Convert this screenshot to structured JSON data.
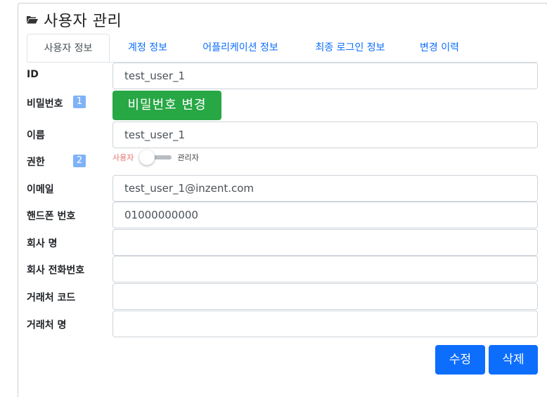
{
  "page": {
    "title": "사용자 관리",
    "title_icon": "folder-open-icon"
  },
  "tabs": [
    {
      "label": "사용자 정보",
      "active": true
    },
    {
      "label": "계정 정보"
    },
    {
      "label": "어플리케이션 정보"
    },
    {
      "label": "최종 로그인 정보"
    },
    {
      "label": "변경 이력"
    }
  ],
  "form": {
    "id": {
      "label": "ID",
      "value": "test_user_1"
    },
    "password": {
      "label": "비밀번호",
      "badge": "1",
      "button_label": "비밀번호 변경"
    },
    "name": {
      "label": "이름",
      "value": "test_user_1"
    },
    "role": {
      "label": "권한",
      "badge": "2",
      "option_off": "사용자",
      "option_on": "관리자",
      "is_admin": false
    },
    "email": {
      "label": "이메일",
      "value": "test_user_1@inzent.com"
    },
    "phone": {
      "label": "핸드폰 번호",
      "value": "01000000000"
    },
    "company": {
      "label": "회사 명",
      "value": ""
    },
    "company_phone": {
      "label": "회사 전화번호",
      "value": ""
    },
    "vendor_code": {
      "label": "거래처 코드",
      "value": ""
    },
    "vendor_name": {
      "label": "거래처 명",
      "value": ""
    }
  },
  "actions": {
    "edit_label": "수정",
    "delete_label": "삭제"
  },
  "colors": {
    "primary": "#0d6efd",
    "success": "#28a745",
    "badge": "#7fb2f7",
    "toggle_off_label": "#e57373"
  }
}
